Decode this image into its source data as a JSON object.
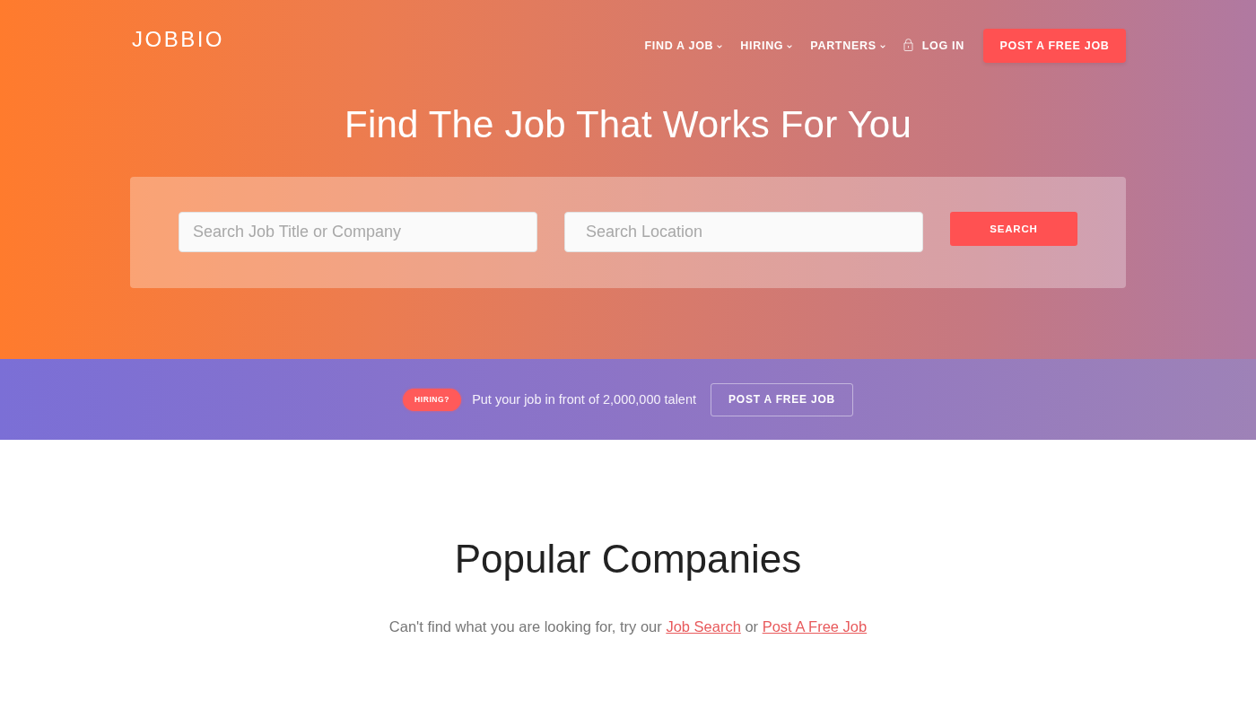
{
  "header": {
    "logo": "JOBBIO",
    "nav": [
      {
        "label": "FIND A JOB",
        "kind": "dropdown"
      },
      {
        "label": "HIRING",
        "kind": "dropdown"
      },
      {
        "label": "PARTNERS",
        "kind": "dropdown"
      },
      {
        "label": "LOG IN",
        "kind": "login"
      }
    ],
    "cta": "POST A FREE JOB"
  },
  "hero": {
    "title": "Find The Job That Works For You",
    "search": {
      "fields": [
        {
          "placeholder": "Search Job Title or Company"
        },
        {
          "placeholder": "Search Location"
        }
      ],
      "button": "SEARCH"
    }
  },
  "banner": {
    "badge": "HIRING?",
    "text": "Put your job in front of 2,000,000 talent",
    "button": "POST A FREE JOB"
  },
  "companies": {
    "title": "Popular Companies",
    "prompt": [
      {
        "kind": "text",
        "text": "Can't find what you are looking for, try our "
      },
      {
        "kind": "link",
        "text": "Job Search"
      },
      {
        "kind": "text",
        "text": " or "
      },
      {
        "kind": "link",
        "text": "Post A Free Job"
      }
    ]
  }
}
